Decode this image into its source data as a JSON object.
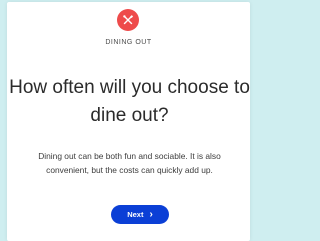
{
  "screen": {
    "category_icon": "utensils-icon",
    "category_label": "DINING OUT",
    "question_line1": "How often will you choose to",
    "question_line2": "dine out?",
    "description_line1": "Dining out can be both fun and sociable. It is also",
    "description_line2": "convenient, but the costs can quickly add up.",
    "next_label": "Next",
    "next_icon": "chevron-right-icon"
  },
  "colors": {
    "background": "#cfeef0",
    "card": "#ffffff",
    "icon_bg": "#ee4b4b",
    "button": "#0b3fd6"
  }
}
